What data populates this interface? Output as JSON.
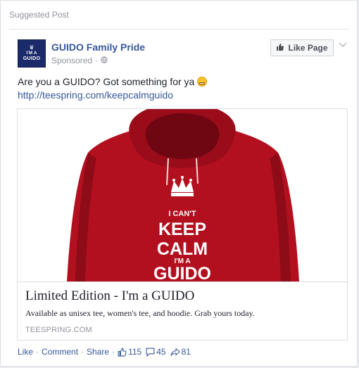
{
  "header": {
    "label": "Suggested Post"
  },
  "page": {
    "logo_line1": "I'M A",
    "logo_line2": "GUIDO",
    "name": "GUIDO Family Pride",
    "sponsored": "Sponsored",
    "dot": "·",
    "like_page_label": "Like Page"
  },
  "post": {
    "text": "Are you a GUIDO? Got something for ya",
    "link": "http://teespring.com/keepcalmguido"
  },
  "attachment": {
    "image_text": {
      "line1": "I CAN'T",
      "line2": "KEEP",
      "line3": "CALM",
      "line4": "I'M A",
      "line5": "GUIDO"
    },
    "title": "Limited Edition - I'm a GUIDO",
    "description": "Available as unisex tee, women's tee, and hoodie. Grab yours today.",
    "domain": "TEESPRING.COM"
  },
  "actions": {
    "like": "Like",
    "comment": "Comment",
    "share": "Share",
    "sep": "·",
    "likes_count": "115",
    "comments_count": "45",
    "shares_count": "81"
  },
  "colors": {
    "link_blue": "#365899",
    "hoodie_red": "#b3101f",
    "logo_navy": "#1b2a6b"
  }
}
